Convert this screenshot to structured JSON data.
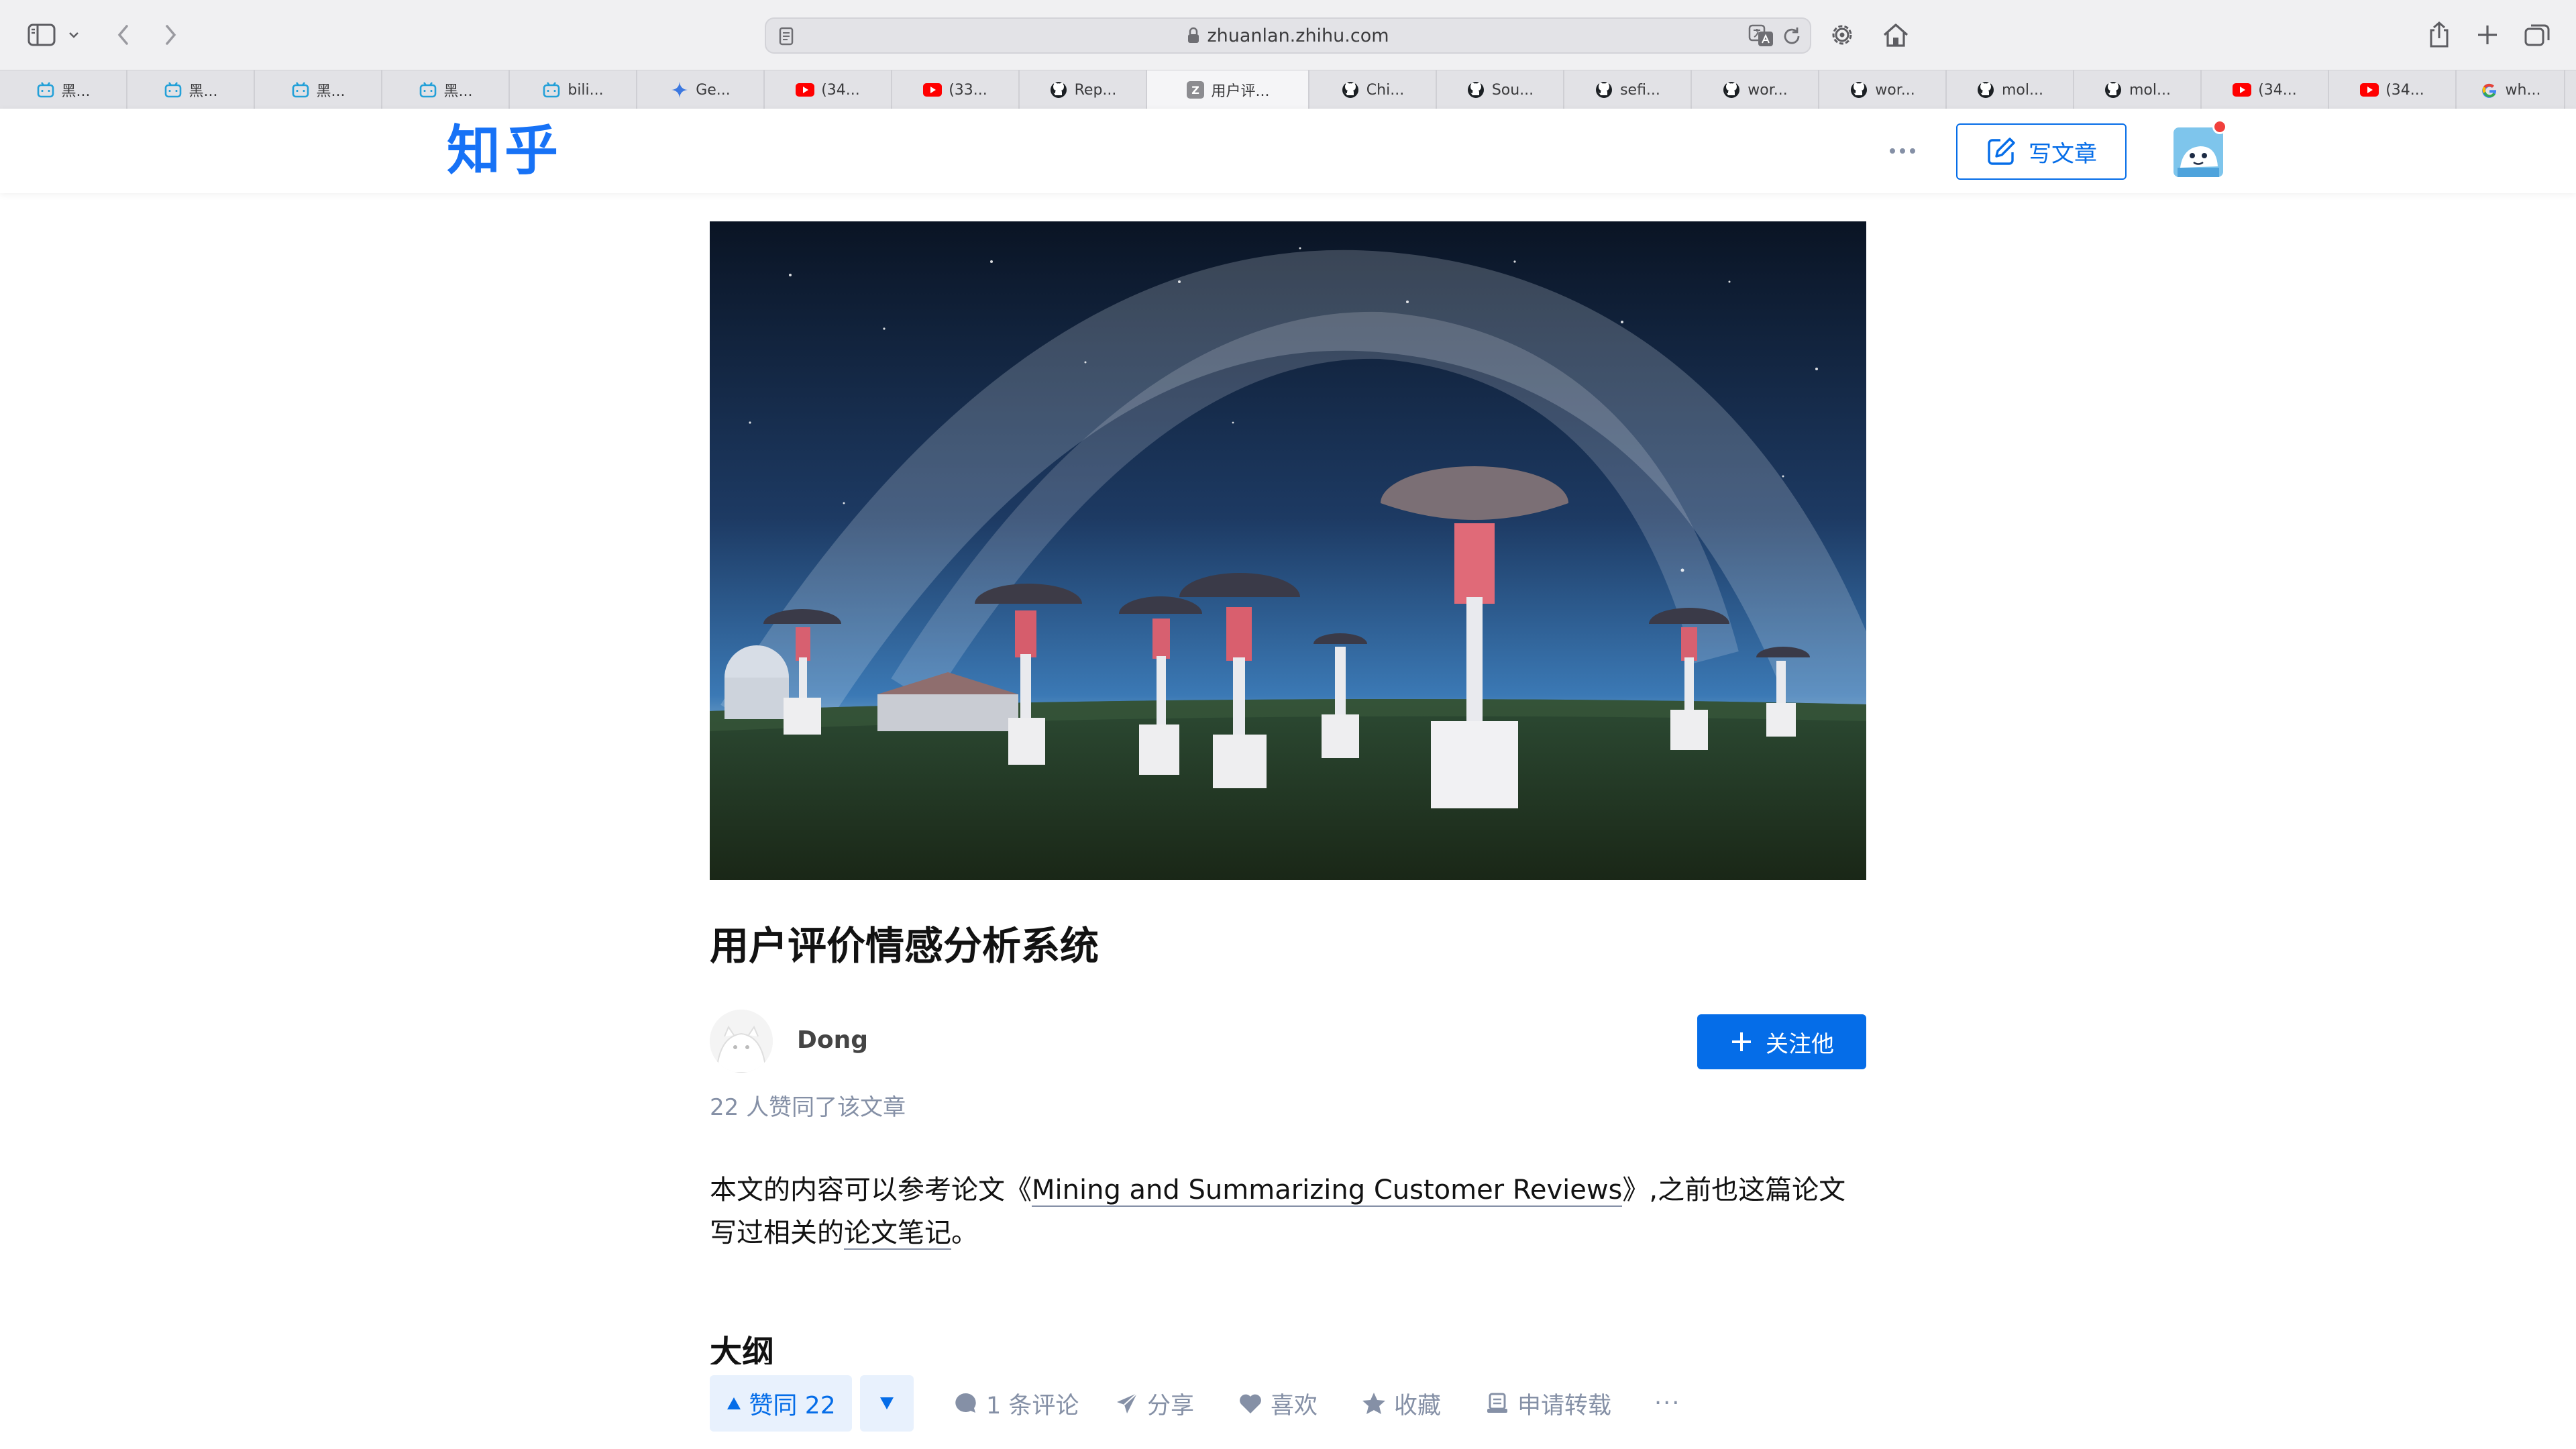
{
  "browser": {
    "url": "zhuanlan.zhihu.com",
    "tabs": [
      {
        "label": "黑...",
        "icon": "bilibili-icon"
      },
      {
        "label": "黑...",
        "icon": "bilibili-icon"
      },
      {
        "label": "黑...",
        "icon": "bilibili-icon"
      },
      {
        "label": "黑...",
        "icon": "bilibili-icon"
      },
      {
        "label": "bili...",
        "icon": "bilibili-icon"
      },
      {
        "label": "Ge...",
        "icon": "gemini-icon"
      },
      {
        "label": "(34...",
        "icon": "youtube-icon"
      },
      {
        "label": "(33...",
        "icon": "youtube-icon"
      },
      {
        "label": "Rep...",
        "icon": "github-icon"
      },
      {
        "label": "用户评...",
        "icon": "zhihu-icon"
      },
      {
        "label": "Chi...",
        "icon": "github-icon"
      },
      {
        "label": "Sou...",
        "icon": "github-icon"
      },
      {
        "label": "sefi...",
        "icon": "github-icon"
      },
      {
        "label": "wor...",
        "icon": "github-icon"
      },
      {
        "label": "wor...",
        "icon": "github-icon"
      },
      {
        "label": "mol...",
        "icon": "github-icon"
      },
      {
        "label": "mol...",
        "icon": "github-icon"
      },
      {
        "label": "(34...",
        "icon": "youtube-icon"
      },
      {
        "label": "(34...",
        "icon": "youtube-icon"
      },
      {
        "label": "wh...",
        "icon": "google-icon"
      }
    ],
    "active_tab": 9,
    "zhihu_tab_letter": "Z"
  },
  "header": {
    "logo": "知乎",
    "write_label": "写文章"
  },
  "article": {
    "title": "用户评价情感分析系统",
    "author": "Dong",
    "follow_label": "关注他",
    "likes_note": "22 人赞同了该文章",
    "body": {
      "part1": "本文的内容可以参考论文《",
      "link1": "Mining and Summarizing Customer Reviews",
      "part2": "》,之前也这篇论文写过相关的",
      "link2": "论文笔记",
      "part3": "。"
    },
    "section_heading": "大纲"
  },
  "actions": {
    "upvote_label": "赞同 22",
    "comments_label": "1 条评论",
    "share_label": "分享",
    "like_label": "喜欢",
    "collect_label": "收藏",
    "reprint_label": "申请转载",
    "more_label": "···"
  },
  "colors": {
    "zhihu_blue": "#056de8",
    "logo_blue": "#1772f6",
    "muted_gray": "#8590a6",
    "upvote_bg": "#e8f1fd",
    "notification_red": "#f1403c"
  }
}
